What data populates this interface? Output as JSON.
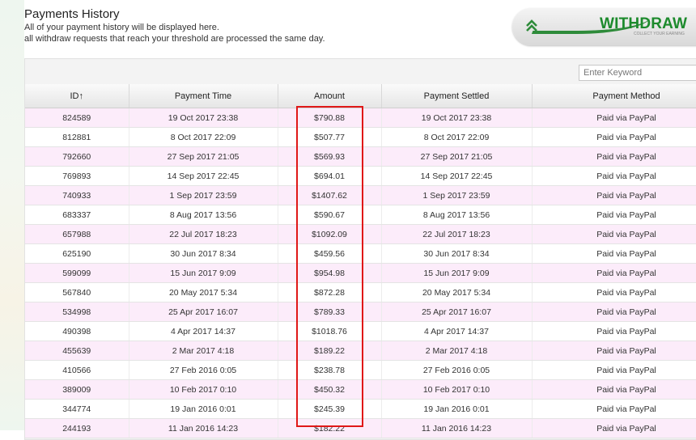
{
  "header": {
    "title": "Payments History",
    "subtitle_line1": "All of your payment history will be displayed here.",
    "subtitle_line2": "all withdraw requests that reach your threshold are processed the same day."
  },
  "withdraw_banner": {
    "label": "WITHDRAW",
    "tagline": "COLLECT YOUR EARNING",
    "icon": "chevron-up-icon",
    "accent": "#1c8a2c"
  },
  "search": {
    "placeholder": "Enter Keyword",
    "value": ""
  },
  "table": {
    "headers": [
      "ID↑",
      "Payment Time",
      "Amount",
      "Payment Settled",
      "Payment Method"
    ],
    "rows": [
      {
        "id": "824589",
        "time": "19 Oct 2017 23:38",
        "amount": "$790.88",
        "settled": "19 Oct 2017 23:38",
        "method": "Paid via PayPal"
      },
      {
        "id": "812881",
        "time": "8 Oct 2017 22:09",
        "amount": "$507.77",
        "settled": "8 Oct 2017 22:09",
        "method": "Paid via PayPal"
      },
      {
        "id": "792660",
        "time": "27 Sep 2017 21:05",
        "amount": "$569.93",
        "settled": "27 Sep 2017 21:05",
        "method": "Paid via PayPal"
      },
      {
        "id": "769893",
        "time": "14 Sep 2017 22:45",
        "amount": "$694.01",
        "settled": "14 Sep 2017 22:45",
        "method": "Paid via PayPal"
      },
      {
        "id": "740933",
        "time": "1 Sep 2017 23:59",
        "amount": "$1407.62",
        "settled": "1 Sep 2017 23:59",
        "method": "Paid via PayPal"
      },
      {
        "id": "683337",
        "time": "8 Aug 2017 13:56",
        "amount": "$590.67",
        "settled": "8 Aug 2017 13:56",
        "method": "Paid via PayPal"
      },
      {
        "id": "657988",
        "time": "22 Jul 2017 18:23",
        "amount": "$1092.09",
        "settled": "22 Jul 2017 18:23",
        "method": "Paid via PayPal"
      },
      {
        "id": "625190",
        "time": "30 Jun 2017 8:34",
        "amount": "$459.56",
        "settled": "30 Jun 2017 8:34",
        "method": "Paid via PayPal"
      },
      {
        "id": "599099",
        "time": "15 Jun 2017 9:09",
        "amount": "$954.98",
        "settled": "15 Jun 2017 9:09",
        "method": "Paid via PayPal"
      },
      {
        "id": "567840",
        "time": "20 May 2017 5:34",
        "amount": "$872.28",
        "settled": "20 May 2017 5:34",
        "method": "Paid via PayPal"
      },
      {
        "id": "534998",
        "time": "25 Apr 2017 16:07",
        "amount": "$789.33",
        "settled": "25 Apr 2017 16:07",
        "method": "Paid via PayPal"
      },
      {
        "id": "490398",
        "time": "4 Apr 2017 14:37",
        "amount": "$1018.76",
        "settled": "4 Apr 2017 14:37",
        "method": "Paid via PayPal"
      },
      {
        "id": "455639",
        "time": "2 Mar 2017 4:18",
        "amount": "$189.22",
        "settled": "2 Mar 2017 4:18",
        "method": "Paid via PayPal"
      },
      {
        "id": "410566",
        "time": "27 Feb 2016 0:05",
        "amount": "$238.78",
        "settled": "27 Feb 2016 0:05",
        "method": "Paid via PayPal"
      },
      {
        "id": "389009",
        "time": "10 Feb 2017 0:10",
        "amount": "$450.32",
        "settled": "10 Feb 2017 0:10",
        "method": "Paid via PayPal"
      },
      {
        "id": "344774",
        "time": "19 Jan 2016 0:01",
        "amount": "$245.39",
        "settled": "19 Jan 2016 0:01",
        "method": "Paid via PayPal"
      },
      {
        "id": "244193",
        "time": "11 Jan 2016 14:23",
        "amount": "$182.22",
        "settled": "11 Jan 2016 14:23",
        "method": "Paid via PayPal"
      }
    ]
  },
  "colors": {
    "row_alt": "#fcecfa",
    "highlight": "#e01818"
  }
}
